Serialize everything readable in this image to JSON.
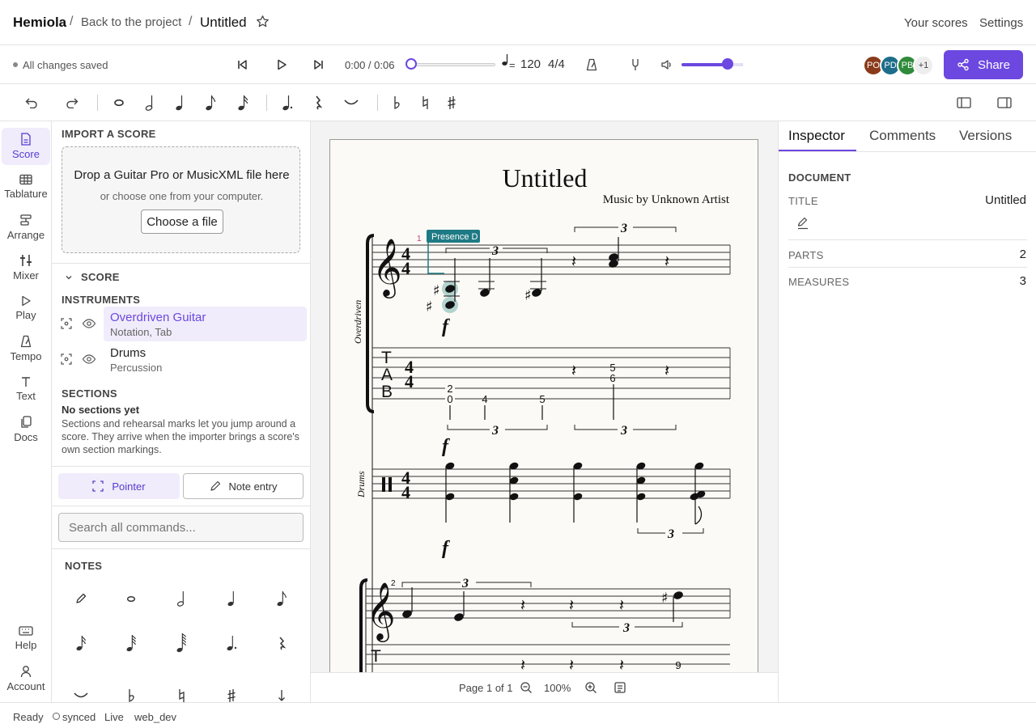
{
  "header": {
    "brand": "Hemiola",
    "sep": "/",
    "back": "Back to the project",
    "title": "Untitled",
    "your_scores": "Your scores",
    "settings": "Settings"
  },
  "transport": {
    "saved": "All changes saved",
    "time": "0:00 / 0:06",
    "progress": 0.0,
    "tempo_eq": "=",
    "tempo": "120",
    "time_signature": "4/4",
    "volume": 0.75,
    "avatars": [
      {
        "initials": "PO",
        "color": "#8a3a1a"
      },
      {
        "initials": "PD",
        "color": "#1d6d8a"
      },
      {
        "initials": "PB",
        "color": "#2f8a3a"
      }
    ],
    "more_avatars": "+1",
    "share": "Share"
  },
  "nav": {
    "items": [
      {
        "label": "Score",
        "icon": "score-icon"
      },
      {
        "label": "Tablature",
        "icon": "grid-icon"
      },
      {
        "label": "Arrange",
        "icon": "arrange-icon"
      },
      {
        "label": "Mixer",
        "icon": "sliders-icon"
      },
      {
        "label": "Play",
        "icon": "play-icon"
      },
      {
        "label": "Tempo",
        "icon": "metronome-icon"
      },
      {
        "label": "Text",
        "icon": "text-icon"
      },
      {
        "label": "Docs",
        "icon": "docs-icon"
      }
    ],
    "help": "Help",
    "account": "Account"
  },
  "import": {
    "heading": "IMPORT A SCORE",
    "title": "Drop a Guitar Pro or MusicXML file here",
    "subtitle": "or choose one from your computer.",
    "button": "Choose a file"
  },
  "score_panel": {
    "heading": "SCORE",
    "instruments_heading": "INSTRUMENTS",
    "instruments": [
      {
        "name": "Overdriven Guitar",
        "sub": "Notation, Tab"
      },
      {
        "name": "Drums",
        "sub": "Percussion"
      }
    ],
    "sections_heading": "SECTIONS",
    "no_sections": "No sections yet",
    "sections_desc": "Sections and rehearsal marks let you jump around a score. They arrive when the importer brings a score's own section markings.",
    "pointer": "Pointer",
    "note_entry": "Note entry",
    "search_placeholder": "Search all commands...",
    "notes_heading": "NOTES"
  },
  "score": {
    "title": "Untitled",
    "composer": "Music by Unknown Artist",
    "marker": "Presence D",
    "measure_1": "1",
    "measure_2": "2",
    "triplet": "3",
    "dynamic": "f",
    "staff_guitar": "Overdriven",
    "staff_drums": "Drums",
    "tab_frets_m1": [
      "2",
      "0",
      "4",
      "5"
    ],
    "tab_frets_m2": [
      "5",
      "6"
    ],
    "tab_fret_m3": "9",
    "page": "Page 1 of 1",
    "zoom": "100%"
  },
  "inspector": {
    "tabs": [
      "Inspector",
      "Comments",
      "Versions"
    ],
    "document_heading": "DOCUMENT",
    "title_label": "TITLE",
    "title_value": "Untitled",
    "parts_label": "PARTS",
    "parts_value": "2",
    "measures_label": "MEASURES",
    "measures_value": "3"
  },
  "status": {
    "ready": "Ready",
    "synced": "synced",
    "live": "Live",
    "env": "web_dev"
  },
  "colors": {
    "accent": "#6c47e0",
    "accent_light": "#f0ecfb",
    "marker": "#1e7a84"
  }
}
